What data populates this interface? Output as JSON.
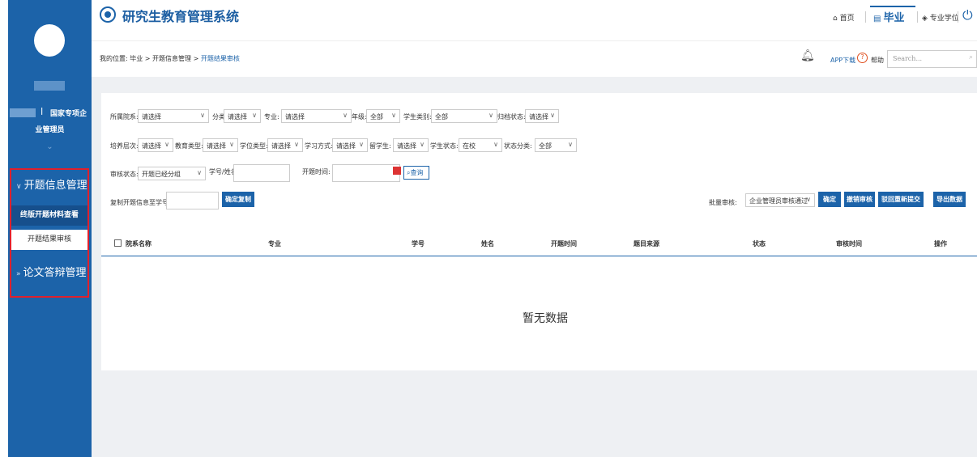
{
  "app": {
    "title": "研究生教育管理系统"
  },
  "topnav": {
    "home": "首页",
    "graduation": "毕业",
    "degree": "专业学位",
    "home_icon": "home-icon",
    "graduation_icon": "document-icon",
    "degree_icon": "graduation-cap-icon",
    "power_icon": "power-icon"
  },
  "user": {
    "org": "国家专项企",
    "role": "业管理员"
  },
  "sidebar": {
    "menus": [
      {
        "label": "开题信息管理",
        "expanded": true
      },
      {
        "label": "论文答辩管理",
        "expanded": false
      }
    ],
    "submenus": [
      {
        "label": "终版开题材料查看",
        "active": true
      },
      {
        "label": "开题结果审核",
        "active": false
      }
    ]
  },
  "breadcrumb": {
    "prefix": "我的位置:",
    "path": "毕业 > 开题信息管理 > ",
    "current": "开题结果审核"
  },
  "toolbar": {
    "app_download": "APP下载",
    "help": "帮助",
    "search_placeholder": "Search..."
  },
  "filters": {
    "college": {
      "label": "所属院系:",
      "value": "请选择"
    },
    "category": {
      "label": "分类:",
      "value": "请选择"
    },
    "major": {
      "label": "专业:",
      "value": "请选择"
    },
    "grade": {
      "label": "年级:",
      "value": "全部"
    },
    "student_type": {
      "label": "学生类别:",
      "value": "全部"
    },
    "archive_status": {
      "label": "归档状态:",
      "value": "请选择"
    },
    "training_level": {
      "label": "培养层次:",
      "value": "请选择"
    },
    "edu_type": {
      "label": "教育类型:",
      "value": "请选择"
    },
    "degree_type": {
      "label": "学位类型:",
      "value": "请选择"
    },
    "study_mode": {
      "label": "学习方式:",
      "value": "请选择"
    },
    "intl_student": {
      "label": "留学生:",
      "value": "请选择"
    },
    "student_status": {
      "label": "学生状态:",
      "value": "在校"
    },
    "status_category": {
      "label": "状态分类:",
      "value": "全部"
    },
    "audit_status": {
      "label": "审核状态:",
      "value": "开题已经分组"
    },
    "id_name": {
      "label": "学号/姓名:",
      "value": ""
    },
    "open_time": {
      "label": "开题时间:",
      "value": ""
    },
    "query_btn": "查询",
    "copy_label": "复制开题信息至学号:",
    "copy_btn": "确定复制"
  },
  "batch": {
    "label": "批量审核:",
    "value": "企业管理员审核通过",
    "confirm": "确定",
    "revoke": "撤销审核",
    "return": "驳回重新提交",
    "export": "导出数据"
  },
  "table": {
    "columns": [
      "院系名称",
      "专业",
      "学号",
      "姓名",
      "开题时间",
      "题目来源",
      "状态",
      "审核时间",
      "操作"
    ],
    "empty_text": "暂无数据"
  }
}
